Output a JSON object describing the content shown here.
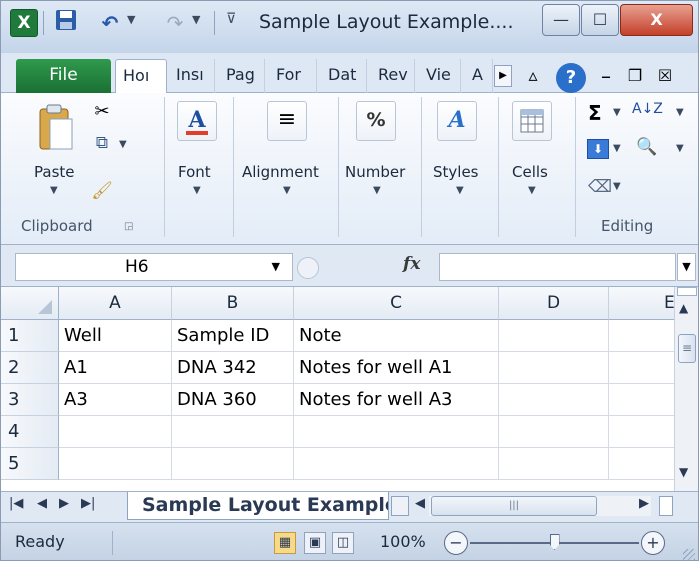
{
  "window": {
    "title": "Sample Layout Example....",
    "app_icon": "excel-icon",
    "controls": [
      "minimize",
      "maximize",
      "close"
    ],
    "min_glyph": "—",
    "max_glyph": "☐",
    "close_glyph": "X"
  },
  "quick_access": {
    "save_glyph": "💾",
    "undo_glyph": "↶",
    "redo_glyph": "↷"
  },
  "ribbon_tabs": {
    "file": "File",
    "tabs": [
      "Hoı",
      "Insı",
      "Pag",
      "For",
      "Dat",
      "Rev",
      "Vie",
      "A"
    ],
    "active_index": 0
  },
  "ribbon": {
    "clipboard": {
      "paste": "Paste",
      "group": "Clipboard"
    },
    "font": {
      "label": "Font",
      "glyph": "A"
    },
    "alignment": {
      "label": "Alignment",
      "glyph": "≡"
    },
    "number": {
      "label": "Number",
      "glyph": "%"
    },
    "styles": {
      "label": "Styles",
      "glyph": "A"
    },
    "cells": {
      "label": "Cells"
    },
    "editing": {
      "group": "Editing",
      "sum_glyph": "Σ",
      "sort_glyph": "A↓Z",
      "find_glyph": "🔍"
    }
  },
  "formula_bar": {
    "name_box": "H6",
    "fx_label": "fx",
    "formula": ""
  },
  "grid": {
    "columns": [
      "A",
      "B",
      "C",
      "D",
      "E"
    ],
    "rows": [
      {
        "num": "1",
        "cells": [
          "Well",
          "Sample ID",
          "Note",
          "",
          ""
        ]
      },
      {
        "num": "2",
        "cells": [
          "A1",
          "DNA 342",
          "Notes for well A1",
          "",
          ""
        ]
      },
      {
        "num": "3",
        "cells": [
          "A3",
          "DNA 360",
          "Notes for well A3",
          "",
          ""
        ]
      },
      {
        "num": "4",
        "cells": [
          "",
          "",
          "",
          "",
          ""
        ]
      },
      {
        "num": "5",
        "cells": [
          "",
          "",
          "",
          "",
          ""
        ]
      }
    ]
  },
  "sheets": {
    "active": "Sample Layout Example"
  },
  "status": {
    "text": "Ready",
    "zoom": "100%",
    "zoom_level": 0.5
  }
}
